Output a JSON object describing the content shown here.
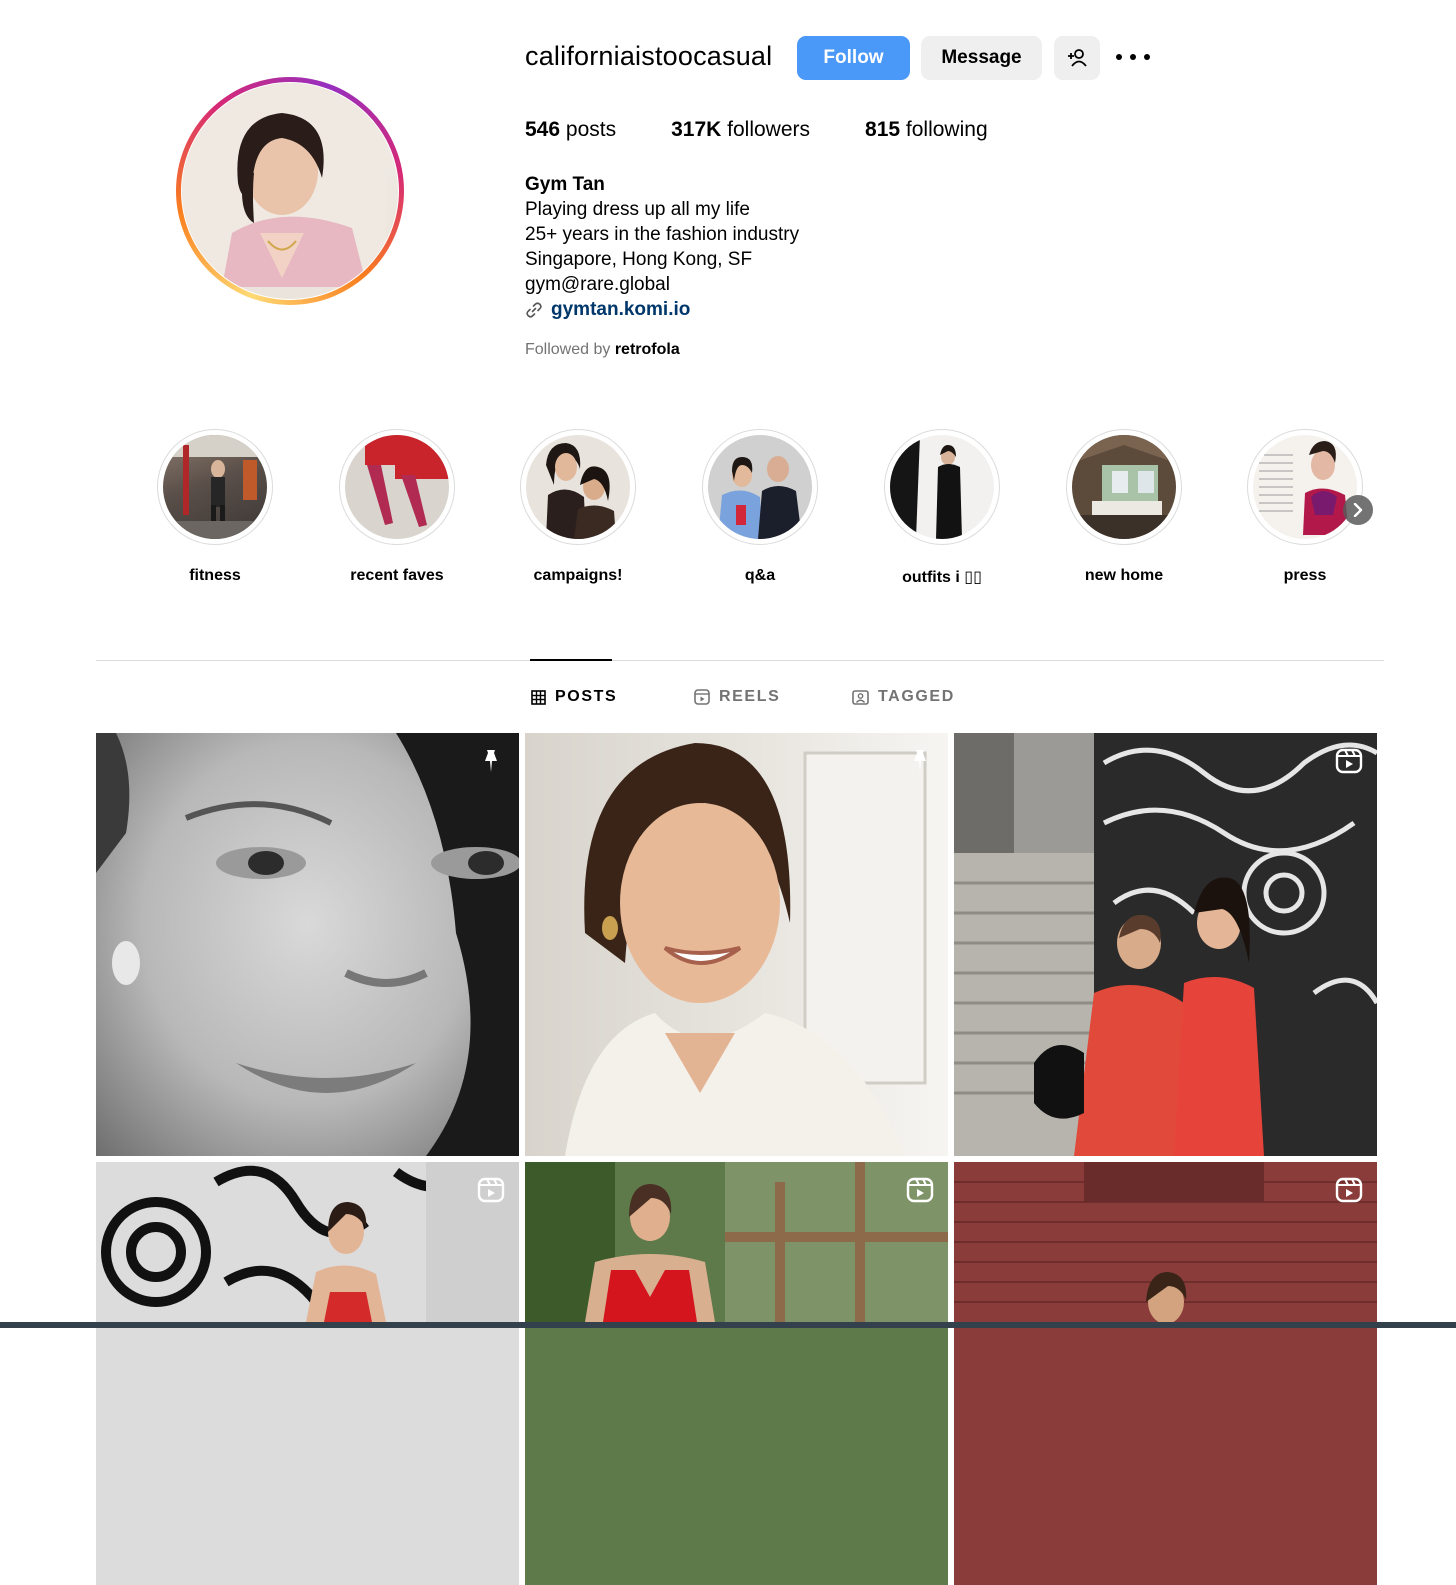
{
  "profile": {
    "username": "californiaistoocasual",
    "follow_label": "Follow",
    "message_label": "Message",
    "stats": {
      "posts_count": "546",
      "posts_label": "posts",
      "followers_count": "317K",
      "followers_label": "followers",
      "following_count": "815",
      "following_label": "following"
    },
    "bio": {
      "name": "Gym Tan",
      "line1": "Playing dress up all my life",
      "line2": "25+ years in the fashion industry",
      "line3": "Singapore, Hong Kong, SF",
      "line4": "gym@rare.global",
      "link": "gymtan.komi.io"
    },
    "followed_by_prefix": "Followed by",
    "followed_by_user": "retrofola"
  },
  "highlights": [
    {
      "label": "fitness"
    },
    {
      "label": "recent faves"
    },
    {
      "label": "campaigns!"
    },
    {
      "label": "q&a"
    },
    {
      "label": "outfits i ▯▯"
    },
    {
      "label": "new home"
    },
    {
      "label": "press"
    }
  ],
  "tabs": [
    {
      "label": "POSTS",
      "icon": "grid-icon",
      "active": true
    },
    {
      "label": "REELS",
      "icon": "reels-icon",
      "active": false
    },
    {
      "label": "TAGGED",
      "icon": "tagged-icon",
      "active": false
    }
  ],
  "posts": [
    {
      "badge": "pin-icon"
    },
    {
      "badge": "pin-icon"
    },
    {
      "badge": "reel-icon"
    },
    {
      "badge": "reel-icon"
    },
    {
      "badge": "reel-icon"
    },
    {
      "badge": "reel-icon"
    }
  ],
  "colors": {
    "follow_button": "#4a98f7",
    "link": "#00376b",
    "muted_text": "#737373"
  }
}
